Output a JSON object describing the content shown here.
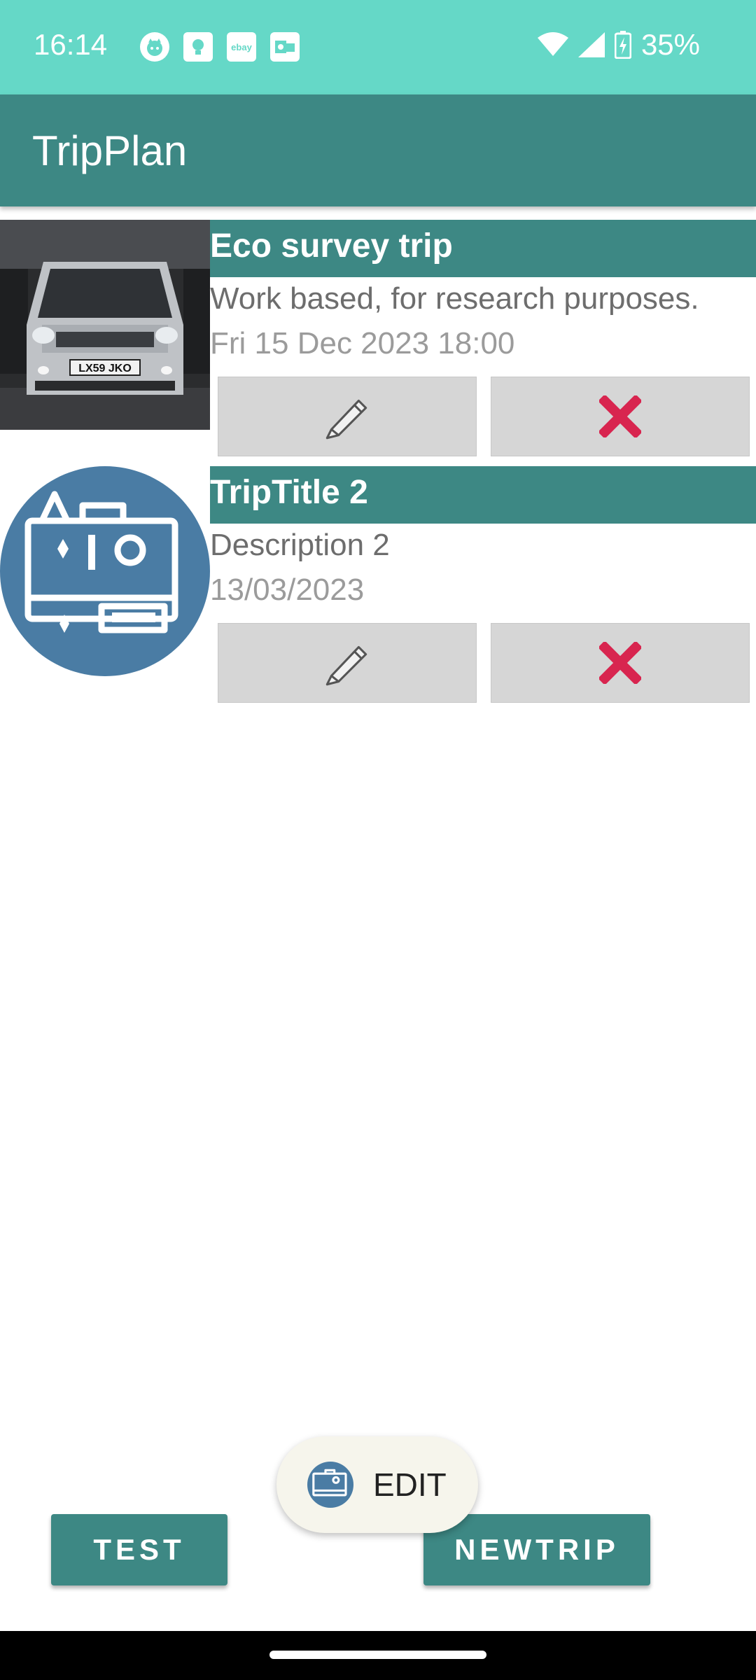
{
  "status_bar": {
    "time": "16:14",
    "notification_icons": [
      "cat-app-icon",
      "bulb-app-icon",
      "ebay-app-icon",
      "outlook-app-icon"
    ],
    "ebay_label": "ebay",
    "battery": "35%"
  },
  "app_bar": {
    "title": "TripPlan"
  },
  "trips": [
    {
      "title": "Eco survey trip",
      "description": "Work based, for research purposes.",
      "date": "Fri 15 Dec 2023 18:00",
      "image": "van-photo",
      "plate": "LX59 JKO"
    },
    {
      "title": "TripTitle 2",
      "description": "Description 2",
      "date": "13/03/2023",
      "image": "suitcase-logo-icon"
    }
  ],
  "fab": {
    "label": "EDIT"
  },
  "buttons": {
    "test": "TEST",
    "newtrip": "NEWTRIP"
  },
  "colors": {
    "status_bar": "#65d8c7",
    "primary": "#3d8884",
    "delete_red": "#d8254f",
    "logo_blue": "#4a7ca4"
  }
}
